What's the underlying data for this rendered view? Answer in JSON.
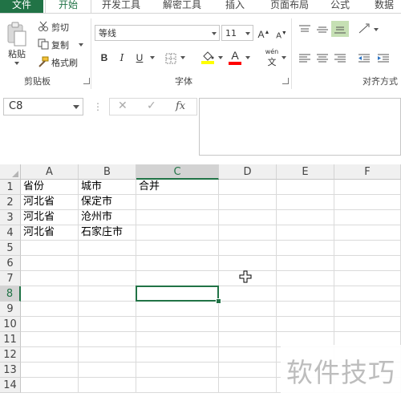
{
  "ribbon_tabs": [
    "文件",
    "开始",
    "开发工具",
    "解密工具",
    "插入",
    "页面布局",
    "公式",
    "数据"
  ],
  "clipboard": {
    "paste": "粘贴",
    "cut": "剪切",
    "copy": "复制",
    "format_painter": "格式刷",
    "group_label": "剪贴板"
  },
  "font": {
    "name": "等线",
    "size": "11",
    "grow": "A",
    "shrink": "A",
    "bold": "B",
    "italic": "I",
    "underline": "U",
    "font_color_glyph": "A",
    "phonetic_top": "wén",
    "phonetic_bottom": "文",
    "group_label": "字体",
    "fill_color": "#ffff00",
    "font_color": "#ff0000"
  },
  "alignment": {
    "group_label": "对齐方式"
  },
  "name_box": "C8",
  "formula_bar": {
    "cancel": "✕",
    "enter": "✓",
    "fx": "fx",
    "content": ""
  },
  "columns": [
    "A",
    "B",
    "C",
    "D",
    "E",
    "F"
  ],
  "rows": [
    "1",
    "2",
    "3",
    "4",
    "5",
    "6",
    "7",
    "8",
    "9",
    "10",
    "11",
    "12",
    "13",
    "14"
  ],
  "cells": {
    "A1": "省份",
    "B1": "城市",
    "C1": "合并",
    "A2": "河北省",
    "B2": "保定市",
    "A3": "河北省",
    "B3": "沧州市",
    "A4": "河北省",
    "B4": "石家庄市"
  },
  "selected_cell": "C8",
  "accent_color": "#217346",
  "watermark": "软件技巧"
}
